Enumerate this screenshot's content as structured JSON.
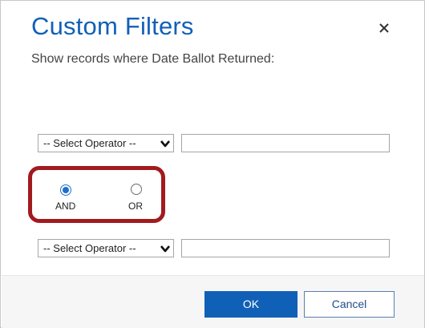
{
  "dialog": {
    "title": "Custom Filters",
    "subtitle": "Show records where Date Ballot Returned:",
    "close_icon": "close-icon"
  },
  "filter1": {
    "operator": "-- Select Operator --",
    "value": ""
  },
  "logic": {
    "options": [
      {
        "label": "AND",
        "checked": true
      },
      {
        "label": "OR",
        "checked": false
      }
    ]
  },
  "filter2": {
    "operator": "-- Select Operator --",
    "value": ""
  },
  "footer": {
    "ok_label": "OK",
    "cancel_label": "Cancel"
  },
  "colors": {
    "accent": "#1160b7",
    "highlight": "#a21a1f"
  }
}
